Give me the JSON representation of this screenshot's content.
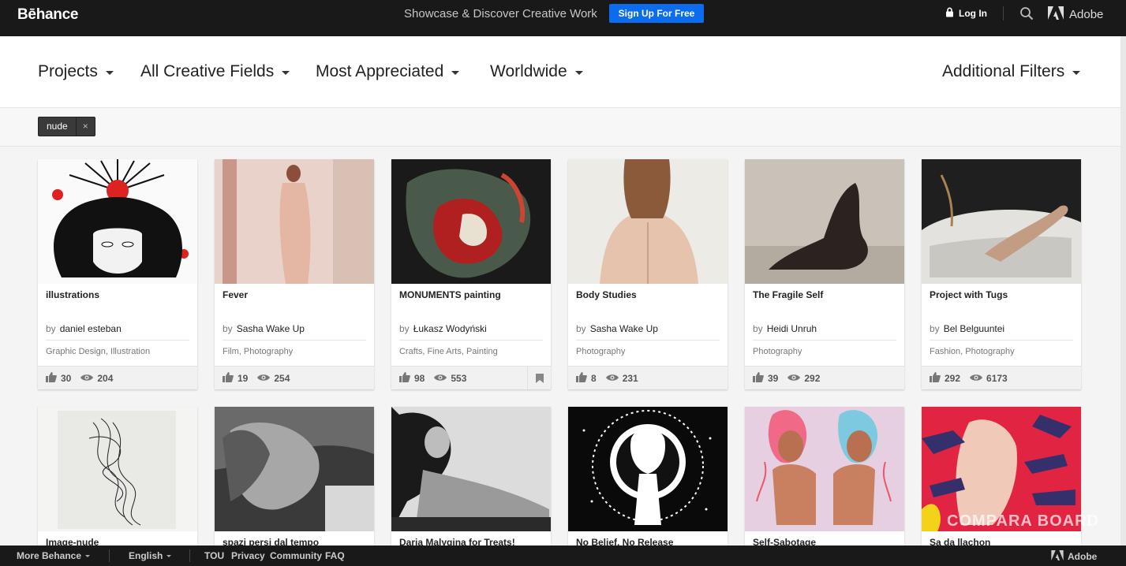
{
  "header": {
    "logo": "Bēhance",
    "tagline": "Showcase & Discover Creative Work",
    "signup_label": "Sign Up For Free",
    "login_label": "Log In",
    "adobe_label": "Adobe"
  },
  "filters": {
    "projects": "Projects",
    "fields": "All Creative Fields",
    "sort": "Most Appreciated",
    "location": "Worldwide",
    "additional": "Additional Filters"
  },
  "active_tag": {
    "label": "nude",
    "remove": "×"
  },
  "cards": [
    {
      "title": "illustrations",
      "by": "by",
      "author": "daniel esteban",
      "fields": "Graphic Design, Illustration",
      "likes": "30",
      "views": "204"
    },
    {
      "title": "Fever",
      "by": "by",
      "author": "Sasha Wake Up",
      "fields": "Film, Photography",
      "likes": "19",
      "views": "254"
    },
    {
      "title": "MONUMENTS painting",
      "by": "by",
      "author": "Łukasz Wodyński",
      "fields": "Crafts, Fine Arts, Painting",
      "likes": "98",
      "views": "553"
    },
    {
      "title": "Body Studies",
      "by": "by",
      "author": "Sasha Wake Up",
      "fields": "Photography",
      "likes": "8",
      "views": "231"
    },
    {
      "title": "The Fragile Self",
      "by": "by",
      "author": "Heidi Unruh",
      "fields": "Photography",
      "likes": "39",
      "views": "292"
    },
    {
      "title": "Project with Tugs",
      "by": "by",
      "author": "Bel Belguuntei",
      "fields": "Fashion, Photography",
      "likes": "292",
      "views": "6173"
    },
    {
      "title": "Image-nude"
    },
    {
      "title": "spazi persi dal tempo"
    },
    {
      "title": "Daria Malygina for Treats!"
    },
    {
      "title": "No Belief, No Release"
    },
    {
      "title": "Self-Sabotage"
    },
    {
      "title": "Sa da llachon"
    }
  ],
  "footer": {
    "more": "More Behance",
    "language": "English",
    "tou": "TOU",
    "privacy": "Privacy",
    "community": "Community",
    "faq": "FAQ",
    "adobe": "Adobe"
  },
  "watermark": "COMPARA BOARD",
  "colors": {
    "topbar": "#191919",
    "signup": "#0b6cf0"
  }
}
